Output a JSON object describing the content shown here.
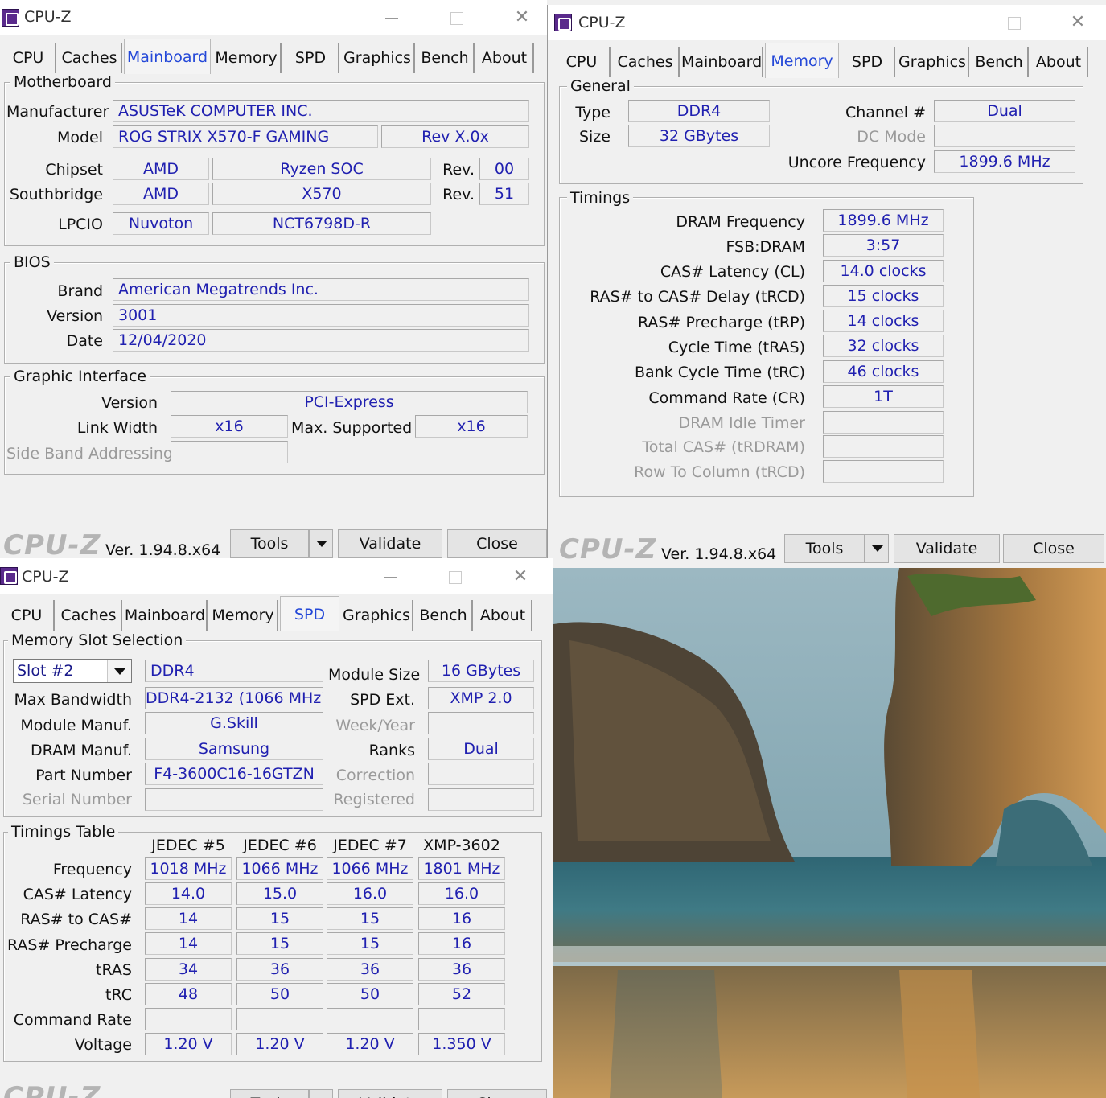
{
  "app_title": "CPU-Z",
  "tabs": [
    "CPU",
    "Caches",
    "Mainboard",
    "Memory",
    "SPD",
    "Graphics",
    "Bench",
    "About"
  ],
  "footer": {
    "logo": "CPU-Z",
    "version": "Ver. 1.94.8.x64",
    "tools": "Tools",
    "validate": "Validate",
    "close": "Close"
  },
  "mainboard": {
    "motherboard_group": "Motherboard",
    "manufacturer_label": "Manufacturer",
    "manufacturer": "ASUSTeK COMPUTER INC.",
    "model_label": "Model",
    "model": "ROG STRIX X570-F GAMING",
    "model_rev": "Rev X.0x",
    "chipset_label": "Chipset",
    "chipset_vendor": "AMD",
    "chipset_name": "Ryzen SOC",
    "chipset_rev_label": "Rev.",
    "chipset_rev": "00",
    "southbridge_label": "Southbridge",
    "southbridge_vendor": "AMD",
    "southbridge_name": "X570",
    "southbridge_rev_label": "Rev.",
    "southbridge_rev": "51",
    "lpcio_label": "LPCIO",
    "lpcio_vendor": "Nuvoton",
    "lpcio_name": "NCT6798D-R",
    "bios_group": "BIOS",
    "brand_label": "Brand",
    "brand": "American Megatrends Inc.",
    "version_label": "Version",
    "version": "3001",
    "date_label": "Date",
    "date": "12/04/2020",
    "gi_group": "Graphic Interface",
    "gi_version_label": "Version",
    "gi_version": "PCI-Express",
    "link_width_label": "Link Width",
    "link_width": "x16",
    "max_supported_label": "Max. Supported",
    "max_supported": "x16",
    "side_band_label": "Side Band Addressing",
    "side_band": ""
  },
  "memory": {
    "general_group": "General",
    "type_label": "Type",
    "type": "DDR4",
    "size_label": "Size",
    "size": "32 GBytes",
    "channel_label": "Channel #",
    "channel": "Dual",
    "dc_mode_label": "DC Mode",
    "dc_mode": "",
    "uncore_label": "Uncore Frequency",
    "uncore": "1899.6 MHz",
    "timings_group": "Timings",
    "timings": [
      {
        "label": "DRAM Frequency",
        "value": "1899.6 MHz",
        "disabled": false
      },
      {
        "label": "FSB:DRAM",
        "value": "3:57",
        "disabled": false
      },
      {
        "label": "CAS# Latency (CL)",
        "value": "14.0 clocks",
        "disabled": false
      },
      {
        "label": "RAS# to CAS# Delay (tRCD)",
        "value": "15 clocks",
        "disabled": false
      },
      {
        "label": "RAS# Precharge (tRP)",
        "value": "14 clocks",
        "disabled": false
      },
      {
        "label": "Cycle Time (tRAS)",
        "value": "32 clocks",
        "disabled": false
      },
      {
        "label": "Bank Cycle Time (tRC)",
        "value": "46 clocks",
        "disabled": false
      },
      {
        "label": "Command Rate (CR)",
        "value": "1T",
        "disabled": false
      },
      {
        "label": "DRAM Idle Timer",
        "value": "",
        "disabled": true
      },
      {
        "label": "Total CAS# (tRDRAM)",
        "value": "",
        "disabled": true
      },
      {
        "label": "Row To Column (tRCD)",
        "value": "",
        "disabled": true
      }
    ]
  },
  "spd": {
    "slot_group": "Memory Slot Selection",
    "slot": "Slot #2",
    "mem_type": "DDR4",
    "module_size_label": "Module Size",
    "module_size": "16 GBytes",
    "max_bw_label": "Max Bandwidth",
    "max_bw": "DDR4-2132 (1066 MHz)",
    "spd_ext_label": "SPD Ext.",
    "spd_ext": "XMP 2.0",
    "module_manuf_label": "Module Manuf.",
    "module_manuf": "G.Skill",
    "week_year_label": "Week/Year",
    "week_year": "",
    "dram_manuf_label": "DRAM Manuf.",
    "dram_manuf": "Samsung",
    "ranks_label": "Ranks",
    "ranks": "Dual",
    "part_label": "Part Number",
    "part": "F4-3600C16-16GTZN",
    "correction_label": "Correction",
    "correction": "",
    "serial_label": "Serial Number",
    "serial": "",
    "registered_label": "Registered",
    "registered": "",
    "timings_group": "Timings Table",
    "columns": [
      "JEDEC #5",
      "JEDEC #6",
      "JEDEC #7",
      "XMP-3602"
    ],
    "rows": [
      {
        "label": "Frequency",
        "values": [
          "1018 MHz",
          "1066 MHz",
          "1066 MHz",
          "1801 MHz"
        ]
      },
      {
        "label": "CAS# Latency",
        "values": [
          "14.0",
          "15.0",
          "16.0",
          "16.0"
        ]
      },
      {
        "label": "RAS# to CAS#",
        "values": [
          "14",
          "15",
          "15",
          "16"
        ]
      },
      {
        "label": "RAS# Precharge",
        "values": [
          "14",
          "15",
          "15",
          "16"
        ]
      },
      {
        "label": "tRAS",
        "values": [
          "34",
          "36",
          "36",
          "36"
        ]
      },
      {
        "label": "tRC",
        "values": [
          "48",
          "50",
          "50",
          "52"
        ]
      },
      {
        "label": "Command Rate",
        "values": [
          "",
          "",
          "",
          ""
        ]
      },
      {
        "label": "Voltage",
        "values": [
          "1.20 V",
          "1.20 V",
          "1.20 V",
          "1.350 V"
        ]
      }
    ]
  }
}
